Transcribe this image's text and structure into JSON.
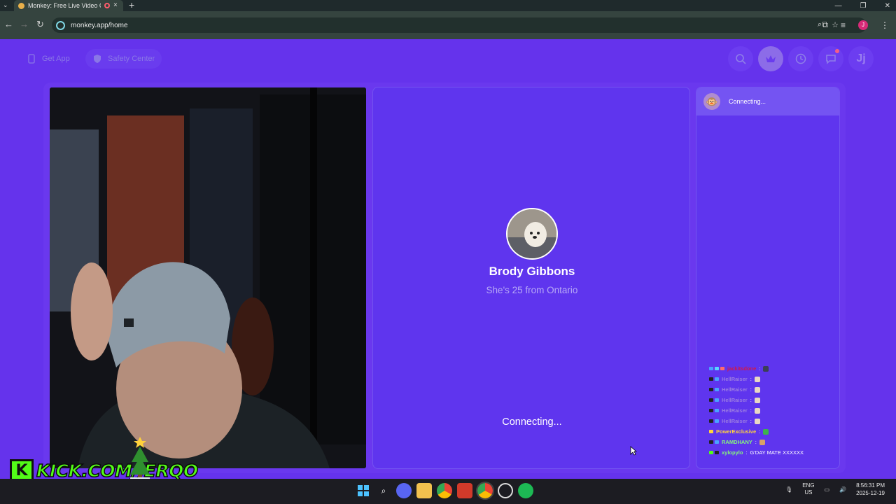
{
  "browser": {
    "tab_title": "Monkey: Free Live Video Ch",
    "url": "monkey.app/home",
    "profile_initial": "J"
  },
  "header": {
    "get_app": "Get App",
    "safety_center": "Safety Center",
    "avatar_letter": "Jj"
  },
  "peer": {
    "name": "Brody Gibbons",
    "meta": "She's 25 from Ontario",
    "connecting": "Connecting..."
  },
  "chat_panel": {
    "status": "Connecting..."
  },
  "stream_chat": [
    {
      "user": "jackitsdone",
      "msg": "",
      "color": "#d1184a"
    },
    {
      "user": "HellRaiser",
      "msg": "",
      "color": "#9c7de0"
    },
    {
      "user": "HellRaiser",
      "msg": "",
      "color": "#9c7de0"
    },
    {
      "user": "HellRaiser",
      "msg": "",
      "color": "#9c7de0"
    },
    {
      "user": "HellRaiser",
      "msg": "",
      "color": "#9c7de0"
    },
    {
      "user": "HellRaiser",
      "msg": "",
      "color": "#9c7de0"
    },
    {
      "user": "PowerExclusive",
      "msg": "",
      "color": "#ffd43b"
    },
    {
      "user": "RAMDHANY",
      "msg": "",
      "color": "#86f77a"
    },
    {
      "user": "xylopylo",
      "msg": "G'DAY MATE XXXXXX",
      "color": "#86f77a"
    }
  ],
  "overlay": {
    "kick_logo": "K",
    "kick_text": "KICK.COM/JERQO"
  },
  "taskbar": {
    "lang_top": "ENG",
    "lang_bottom": "US",
    "time": "8:56:31 PM",
    "date": "2025-12-19"
  }
}
